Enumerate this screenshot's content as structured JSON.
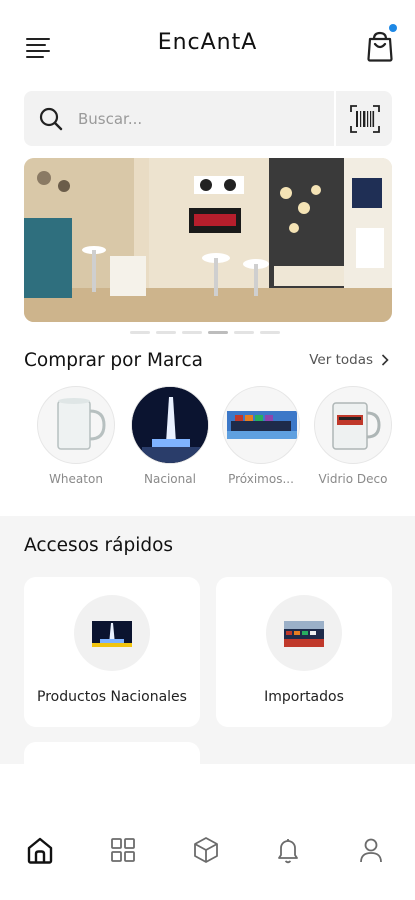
{
  "header": {
    "title": "EncAntA",
    "menu_icon": "hamburger-menu-icon",
    "cart_icon": "shopping-bag-icon",
    "cart_badge_color": "#1e88e5"
  },
  "search": {
    "placeholder": "Buscar...",
    "icon": "search-icon",
    "scan_icon": "barcode-scanner-icon"
  },
  "carousel": {
    "slide_count": 6,
    "active_index": 3
  },
  "brands": {
    "title": "Comprar por Marca",
    "see_all": "Ver todas",
    "items": [
      {
        "label": "Wheaton"
      },
      {
        "label": "Nacional"
      },
      {
        "label": "Próximos..."
      },
      {
        "label": "Vidrio Deco"
      }
    ]
  },
  "quick_access": {
    "title": "Accesos rápidos",
    "cards": [
      {
        "label": "Productos Nacionales"
      },
      {
        "label": "Importados"
      }
    ]
  },
  "bottom_nav": {
    "items": [
      {
        "icon": "home-icon",
        "active": true
      },
      {
        "icon": "grid-icon",
        "active": false
      },
      {
        "icon": "box-icon",
        "active": false
      },
      {
        "icon": "bell-icon",
        "active": false
      },
      {
        "icon": "user-icon",
        "active": false
      }
    ]
  },
  "colors": {
    "accent": "#1e88e5",
    "text_primary": "#111111",
    "text_secondary": "#8a8a8a",
    "surface": "#f2f2f2"
  }
}
